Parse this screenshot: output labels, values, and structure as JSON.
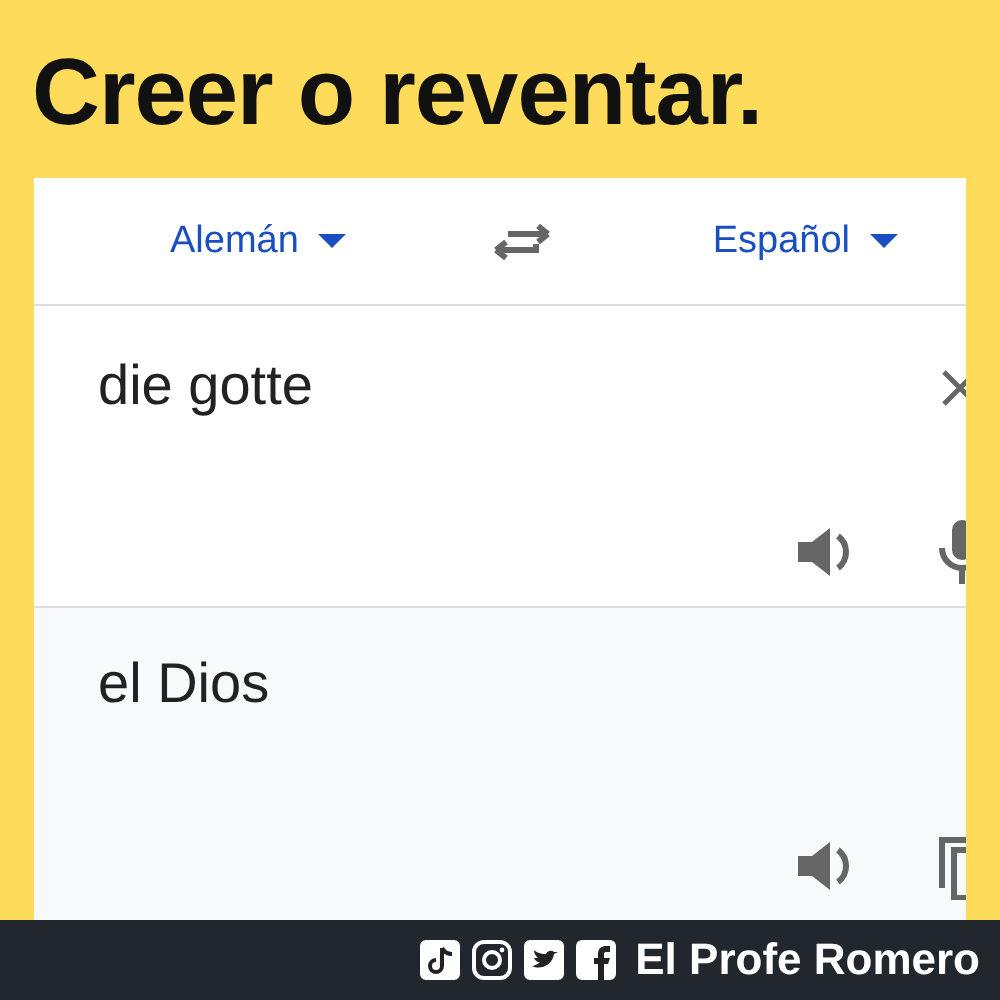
{
  "headline": "Creer o reventar.",
  "translator": {
    "source_language": "Alemán",
    "target_language": "Español",
    "input": {
      "value": "die gotte"
    },
    "output": {
      "text": "el Dios"
    }
  },
  "footer": {
    "brand": "El Profe Romero"
  }
}
